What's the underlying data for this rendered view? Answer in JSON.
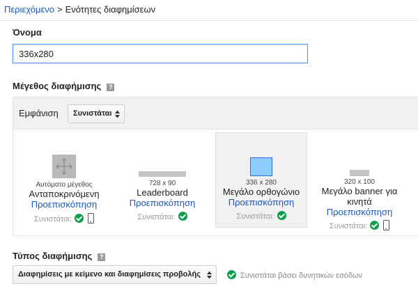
{
  "breadcrumb": {
    "root": "Περιεχόμενο",
    "separator": ">",
    "current": "Ενότητες διαφημίσεων"
  },
  "name_section": {
    "label": "Όνομα",
    "value": "336x280"
  },
  "ad_size": {
    "label": "Μέγεθος διαφήμισης",
    "help_glyph": "?",
    "display_label": "Εμφάνιση",
    "display_select": "Συνιστάται",
    "options": [
      {
        "size_text": "Αυτόματο μέγεθος",
        "name": "Ανταποκρινόμενη",
        "preview": "Προεπισκόπηση",
        "recommended": "Συνιστάται:"
      },
      {
        "size_text": "728 x 90",
        "name": "Leaderboard",
        "preview": "Προεπισκόπηση",
        "recommended": "Συνιστάται:"
      },
      {
        "size_text": "336 x 280",
        "name": "Μεγάλο ορθογώνιο",
        "preview": "Προεπισκόπηση",
        "recommended": "Συνιστάται:",
        "selected": true
      },
      {
        "size_text": "320 x 100",
        "name": "Μεγάλο banner για κινητά",
        "preview": "Προεπισκόπηση",
        "recommended": "Συνιστάται:"
      }
    ]
  },
  "ad_type": {
    "label": "Τύπος διαφήμισης",
    "help_glyph": "?",
    "select_value": "Διαφημίσεις με κείμενο και διαφημίσεις προβολής",
    "recommendation_note": "Συνιστάται βάσει δυνητικών εσόδων"
  },
  "colors": {
    "link": "#1a55c2",
    "focus_border": "#4d90fe",
    "check_green": "#0b9e4b",
    "selected_fill": "#8ecbff"
  },
  "icons": [
    "resize-arrows-icon",
    "check-circle-icon",
    "mobile-phone-icon",
    "help-icon",
    "select-arrows-icon"
  ]
}
